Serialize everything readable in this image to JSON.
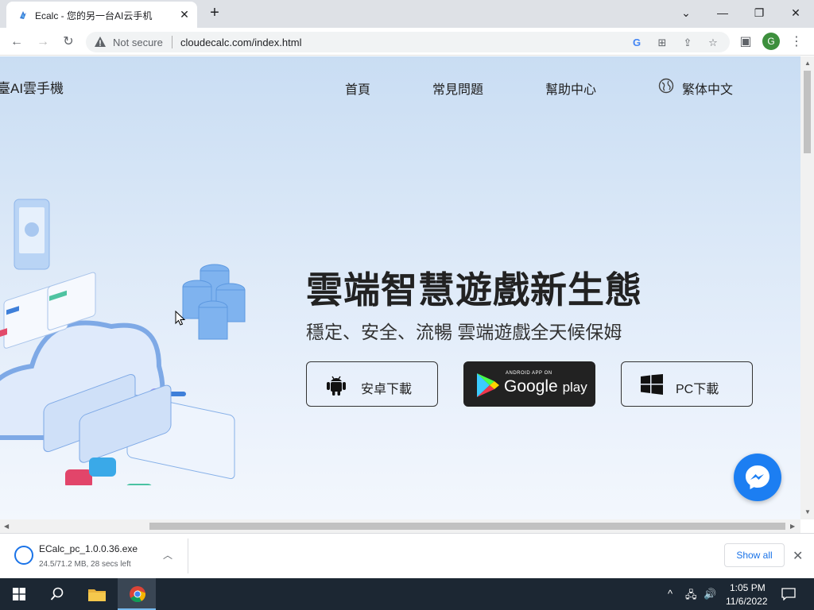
{
  "browser": {
    "tab_title": "Ecalc - 您的另一台AI云手机",
    "security_label": "Not secure",
    "url": "cloudecalc.com/index.html",
    "profile_initial": "G"
  },
  "page": {
    "brand": "臺AI雲手機",
    "nav": [
      "首頁",
      "常見問題",
      "幫助中心",
      "繁体中文"
    ],
    "hero_title": "雲端智慧遊戲新生態",
    "hero_subtitle": "穩定、安全、流暢 雲端遊戲全天候保姆",
    "buttons": {
      "android": "安卓下載",
      "gplay_small": "ANDROID APP ON",
      "gplay_google": "Google",
      "gplay_play": "play",
      "pc": "PC下載"
    }
  },
  "download": {
    "filename": "ECalc_pc_1.0.0.36.exe",
    "status": "24.5/71.2 MB, 28 secs left",
    "show_all": "Show all"
  },
  "taskbar": {
    "time": "1:05 PM",
    "date": "11/6/2022"
  },
  "colors": {
    "accent": "#1a73e8",
    "messenger": "#1c7ef2",
    "hero_bg": "#d9e7f7"
  }
}
